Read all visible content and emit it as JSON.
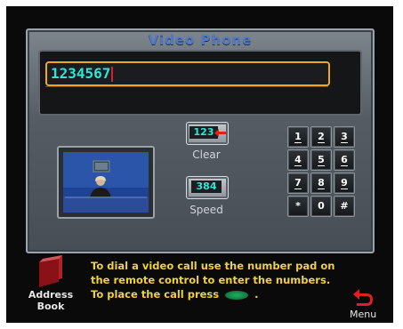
{
  "window": {
    "title": "Video Phone"
  },
  "display": {
    "number": "1234567"
  },
  "buttons": {
    "clear_lcd": "123",
    "clear_label": "Clear",
    "speed_lcd": "384",
    "speed_label": "Speed"
  },
  "keypad": {
    "keys": [
      "1",
      "2",
      "3",
      "4",
      "5",
      "6",
      "7",
      "8",
      "9",
      "*",
      "0",
      "#"
    ]
  },
  "footer": {
    "address_line1": "Address",
    "address_line2": "Book",
    "instruction_line1": "To dial a video call use the number pad on",
    "instruction_line2": "the remote control to enter the numbers.",
    "instruction_line3_pre": "To place the call press",
    "instruction_line3_post": ".",
    "menu_label": "Menu"
  },
  "colors": {
    "accent_orange": "#f0a81e",
    "lcd_cyan": "#2ee6d6",
    "instruction_yellow": "#f0d233",
    "title_blue": "#4f78c8"
  },
  "icons": [
    "back-arrow-icon",
    "address-book-icon",
    "green-call-oval-icon"
  ]
}
